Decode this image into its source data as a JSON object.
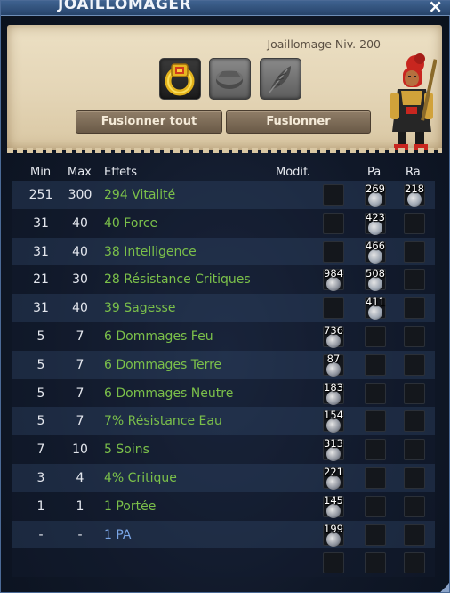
{
  "window": {
    "title": "JOAILLOMAGER",
    "close_icon": "×"
  },
  "workshop": {
    "profession": "Joaillomage Niv. 200",
    "slots": [
      {
        "icon": "gold-ring-icon",
        "filled": true
      },
      {
        "icon": "rune-stone-icon",
        "filled": false
      },
      {
        "icon": "feather-icon",
        "filled": false
      }
    ],
    "buttons": {
      "fuse_all": "Fusionner tout",
      "fuse": "Fusionner"
    },
    "character": "character-portrait-icon"
  },
  "table": {
    "headers": {
      "min": "Min",
      "max": "Max",
      "effects": "Effets",
      "modif": "Modif.",
      "pa": "Pa",
      "ra": "Ra"
    },
    "rows": [
      {
        "min": "251",
        "max": "300",
        "effect": "294 Vitalité",
        "modif": "",
        "pa": "269",
        "ra": "218",
        "color": "green"
      },
      {
        "min": "31",
        "max": "40",
        "effect": "40 Force",
        "modif": "",
        "pa": "423",
        "ra": "",
        "color": "green"
      },
      {
        "min": "31",
        "max": "40",
        "effect": "38 Intelligence",
        "modif": "",
        "pa": "466",
        "ra": "",
        "color": "green"
      },
      {
        "min": "21",
        "max": "30",
        "effect": "28 Résistance Critiques",
        "modif": "984",
        "pa": "508",
        "ra": "",
        "color": "green"
      },
      {
        "min": "31",
        "max": "40",
        "effect": "39 Sagesse",
        "modif": "",
        "pa": "411",
        "ra": "",
        "color": "green"
      },
      {
        "min": "5",
        "max": "7",
        "effect": "6 Dommages Feu",
        "modif": "736",
        "pa": "",
        "ra": "",
        "color": "green"
      },
      {
        "min": "5",
        "max": "7",
        "effect": "6 Dommages Terre",
        "modif": "87",
        "pa": "",
        "ra": "",
        "color": "green"
      },
      {
        "min": "5",
        "max": "7",
        "effect": "6 Dommages Neutre",
        "modif": "183",
        "pa": "",
        "ra": "",
        "color": "green"
      },
      {
        "min": "5",
        "max": "7",
        "effect": "7% Résistance Eau",
        "modif": "154",
        "pa": "",
        "ra": "",
        "color": "green"
      },
      {
        "min": "7",
        "max": "10",
        "effect": "5 Soins",
        "modif": "313",
        "pa": "",
        "ra": "",
        "color": "green"
      },
      {
        "min": "3",
        "max": "4",
        "effect": "4% Critique",
        "modif": "221",
        "pa": "",
        "ra": "",
        "color": "green"
      },
      {
        "min": "1",
        "max": "1",
        "effect": "1 Portée",
        "modif": "145",
        "pa": "",
        "ra": "",
        "color": "green"
      },
      {
        "min": "-",
        "max": "-",
        "effect": "1 PA",
        "modif": "199",
        "pa": "",
        "ra": "",
        "color": "blue"
      },
      {
        "min": "",
        "max": "",
        "effect": "",
        "modif": "",
        "pa": "",
        "ra": "",
        "color": "green"
      }
    ]
  },
  "colors": {
    "effect_green": "#7bc04a",
    "effect_blue": "#7aa6e6",
    "title_bar": "#3f628f"
  }
}
